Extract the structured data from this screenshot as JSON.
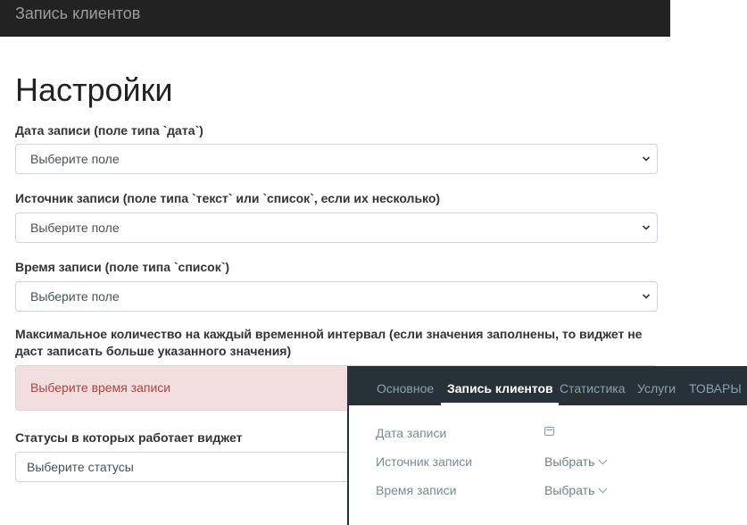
{
  "header": {
    "brand": "Запись клиентов"
  },
  "page": {
    "title": "Настройки"
  },
  "fields": [
    {
      "label": "Дата записи (поле типа `дата`)",
      "value": "Выберите поле"
    },
    {
      "label": "Источник записи (поле типа `текст` или `список`, если их несколько)",
      "value": "Выберите поле"
    },
    {
      "label": "Время записи (поле типа `список`)",
      "value": "Выберите поле"
    }
  ],
  "max_interval": {
    "label_line1": "Максимальное количество на каждый временной интервал (если значения заполнены, то виджет не",
    "label_line2": "даст записать больше указанного значения)",
    "alert": "Выберите время записи"
  },
  "statuses": {
    "label": "Статусы в которых работает виджет",
    "placeholder": "Выберите статусы"
  },
  "overlay": {
    "tabs": [
      "Основное",
      "Запись клиентов",
      "Статистика",
      "Услуги",
      "ТОВАРЫ"
    ],
    "active_tab": "Запись клиентов",
    "rows": [
      {
        "label": "Дата записи",
        "value": "",
        "icon": "calendar-icon"
      },
      {
        "label": "Источник записи",
        "value": "Выбрать",
        "icon": "chevron-down-icon"
      },
      {
        "label": "Время записи",
        "value": "Выбрать",
        "icon": "chevron-down-icon"
      }
    ]
  }
}
